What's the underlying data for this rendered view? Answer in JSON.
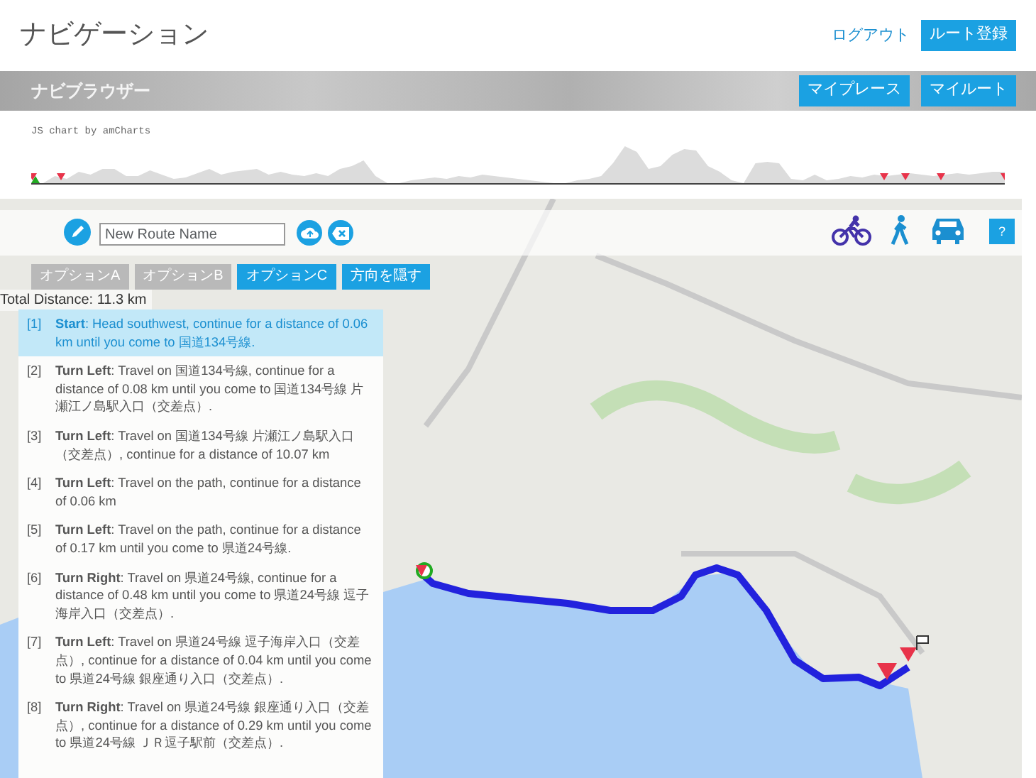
{
  "header": {
    "title": "ナビゲーション",
    "logout_link": "ログアウト",
    "register_button": "ルート登録"
  },
  "banner": {
    "title": "ナビブラウザー",
    "buttons": [
      "マイプレース",
      "マイルート"
    ]
  },
  "elevation_chart": {
    "credit": "JS chart by amCharts"
  },
  "map": {
    "toolbar": {
      "route_name": {
        "placeholder": "New Route Name"
      },
      "modes": [
        {
          "kind": "bicycle",
          "selected": true
        },
        {
          "kind": "walk",
          "selected": false
        },
        {
          "kind": "car",
          "selected": false
        }
      ],
      "help_button": "?"
    },
    "option_tabs": [
      {
        "label": "オプションA",
        "selected": false
      },
      {
        "label": "オプションB",
        "selected": false
      },
      {
        "label": "オプションC",
        "selected": true
      }
    ],
    "hide_directions_button": "方向を隠す",
    "total_distance": "Total Distance: 11.3 km",
    "steps": [
      {
        "number": "[1]",
        "text": "**Start**: Head southwest, continue for a distance of 0.06 km until you come to 国道134号線.",
        "selected": true
      },
      {
        "number": "[2]",
        "text": "**Turn Left**: Travel on 国道134号線, continue for a distance of 0.08 km until you come to 国道134号線 片瀬江ノ島駅入口（交差点）.",
        "selected": false
      },
      {
        "number": "[3]",
        "text": "**Turn Left**: Travel on 国道134号線 片瀬江ノ島駅入口（交差点）, continue for a distance of 10.07 km",
        "selected": false
      },
      {
        "number": "[4]",
        "text": "**Turn Left**: Travel on the path, continue for a distance of 0.06 km",
        "selected": false
      },
      {
        "number": "[5]",
        "text": "**Turn Left**: Travel on the path, continue for a distance of 0.17 km until you come to 県道24号線.",
        "selected": false
      },
      {
        "number": "[6]",
        "text": "**Turn Right**: Travel on 県道24号線, continue for a distance of 0.48 km until you come to 県道24号線 逗子海岸入口（交差点）.",
        "selected": false
      },
      {
        "number": "[7]",
        "text": "**Turn Left**: Travel on 県道24号線 逗子海岸入口（交差点）, continue for a distance of 0.04 km until you come to 県道24号線 銀座通り入口（交差点）.",
        "selected": false
      },
      {
        "number": "[8]",
        "text": "**Turn Right**: Travel on 県道24号線 銀座通り入口（交差点）, continue for a distance of 0.29 km until you come to 県道24号線 ＪＲ逗子駅前（交差点）.",
        "selected": false
      }
    ]
  }
}
